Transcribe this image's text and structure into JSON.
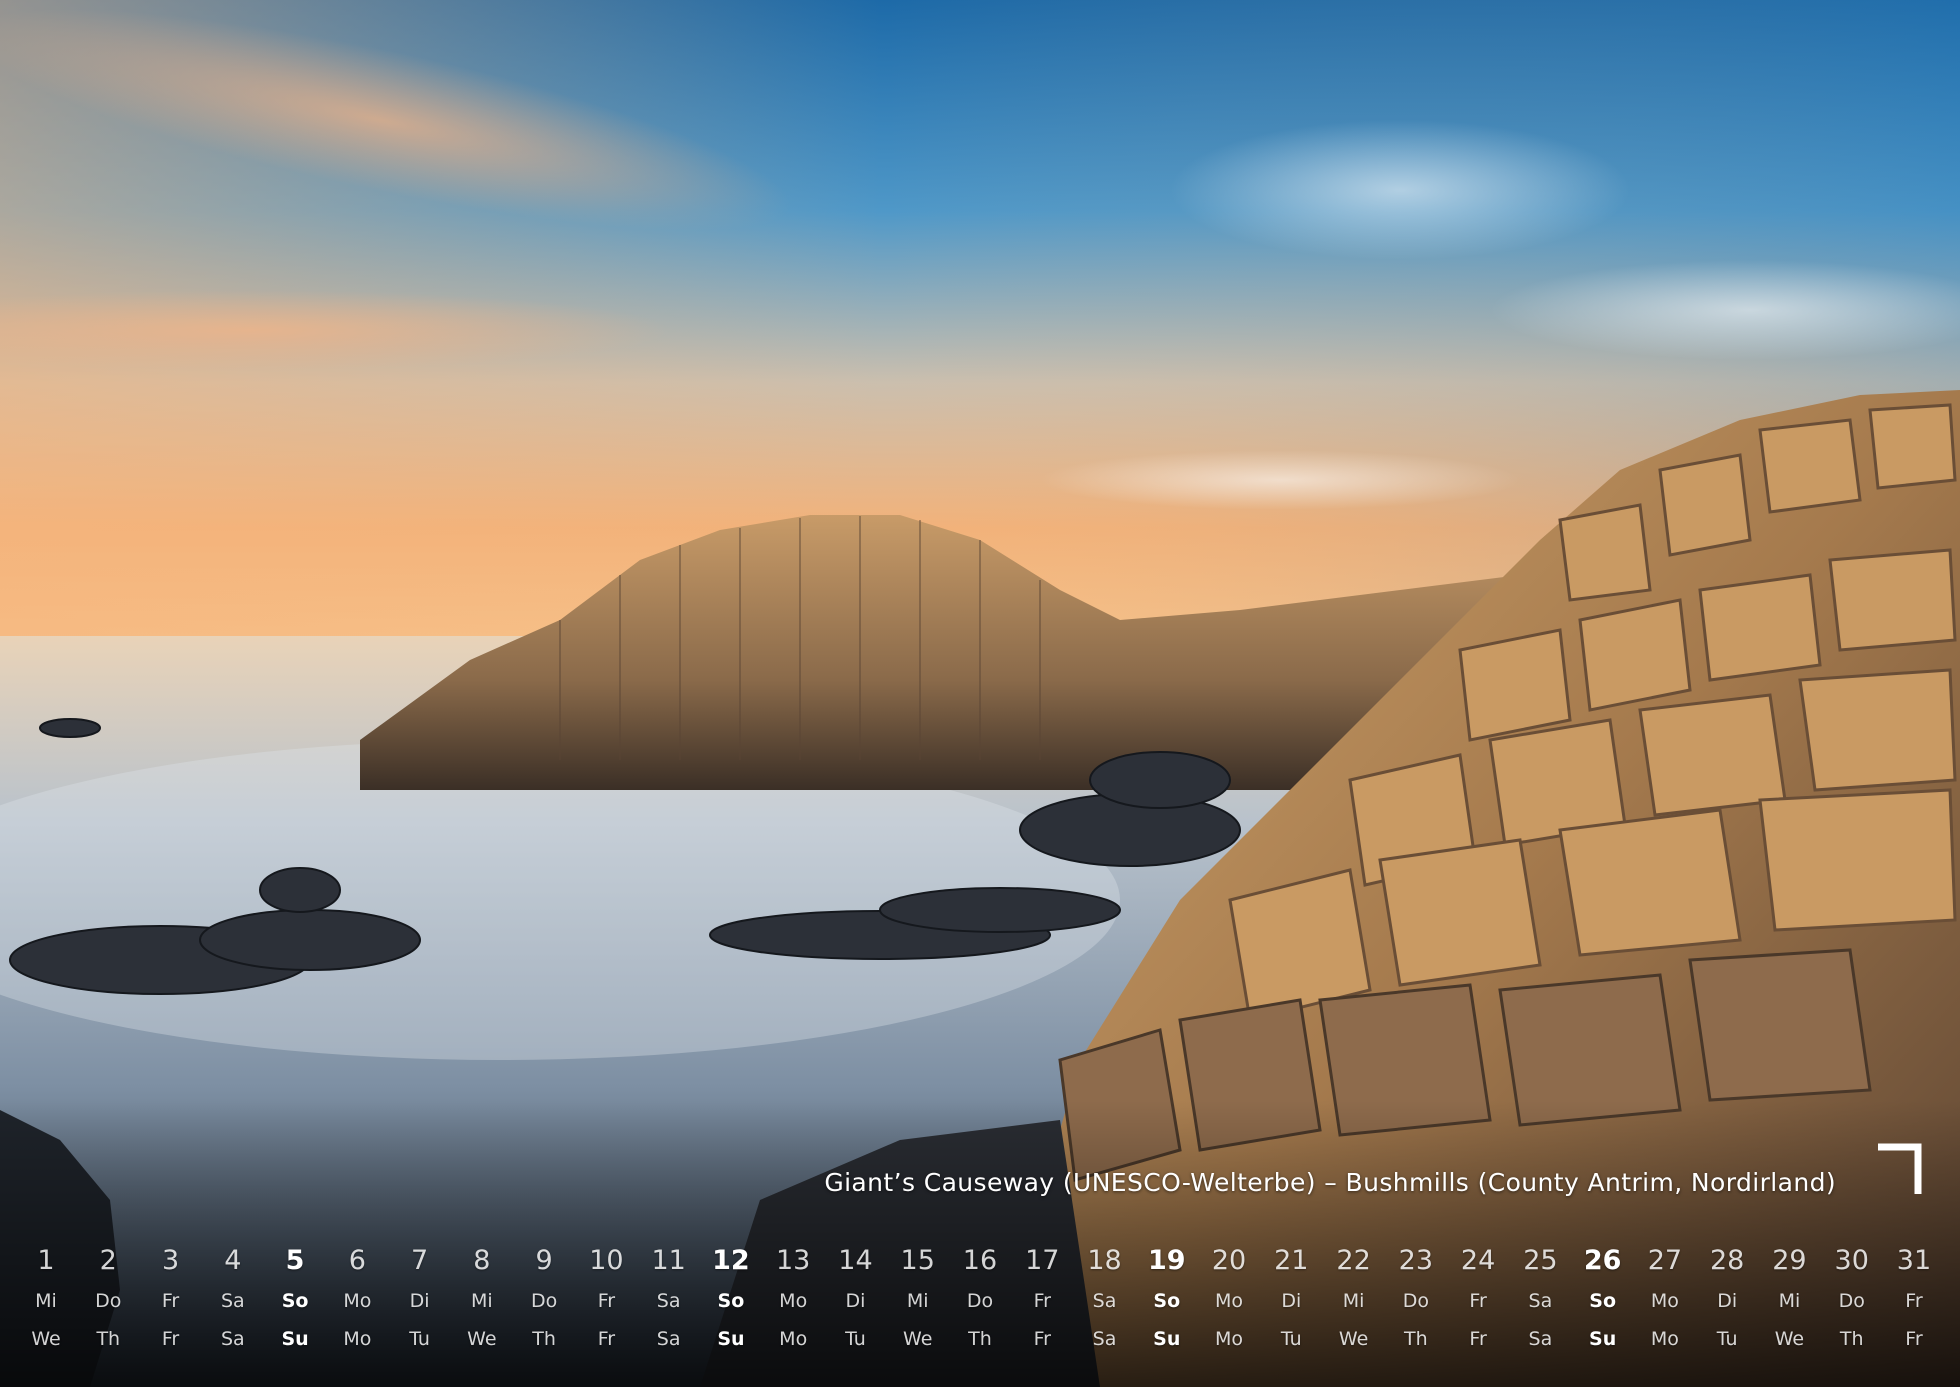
{
  "caption": "Giant’s Causeway (UNESCO-Welterbe) – Bushmills (County Antrim, Nordirland)",
  "month_mark": "7",
  "colors": {
    "text": "#ffffff",
    "sky_top": "#1f6fae",
    "sky_horizon": "#f4b47a",
    "rock": "#b88a58",
    "sea": "#a9b8c6"
  },
  "calendar": {
    "days": [
      {
        "num": "1",
        "de": "Mi",
        "en": "We",
        "sunday": false
      },
      {
        "num": "2",
        "de": "Do",
        "en": "Th",
        "sunday": false
      },
      {
        "num": "3",
        "de": "Fr",
        "en": "Fr",
        "sunday": false
      },
      {
        "num": "4",
        "de": "Sa",
        "en": "Sa",
        "sunday": false
      },
      {
        "num": "5",
        "de": "So",
        "en": "Su",
        "sunday": true
      },
      {
        "num": "6",
        "de": "Mo",
        "en": "Mo",
        "sunday": false
      },
      {
        "num": "7",
        "de": "Di",
        "en": "Tu",
        "sunday": false
      },
      {
        "num": "8",
        "de": "Mi",
        "en": "We",
        "sunday": false
      },
      {
        "num": "9",
        "de": "Do",
        "en": "Th",
        "sunday": false
      },
      {
        "num": "10",
        "de": "Fr",
        "en": "Fr",
        "sunday": false
      },
      {
        "num": "11",
        "de": "Sa",
        "en": "Sa",
        "sunday": false
      },
      {
        "num": "12",
        "de": "So",
        "en": "Su",
        "sunday": true
      },
      {
        "num": "13",
        "de": "Mo",
        "en": "Mo",
        "sunday": false
      },
      {
        "num": "14",
        "de": "Di",
        "en": "Tu",
        "sunday": false
      },
      {
        "num": "15",
        "de": "Mi",
        "en": "We",
        "sunday": false
      },
      {
        "num": "16",
        "de": "Do",
        "en": "Th",
        "sunday": false
      },
      {
        "num": "17",
        "de": "Fr",
        "en": "Fr",
        "sunday": false
      },
      {
        "num": "18",
        "de": "Sa",
        "en": "Sa",
        "sunday": false
      },
      {
        "num": "19",
        "de": "So",
        "en": "Su",
        "sunday": true
      },
      {
        "num": "20",
        "de": "Mo",
        "en": "Mo",
        "sunday": false
      },
      {
        "num": "21",
        "de": "Di",
        "en": "Tu",
        "sunday": false
      },
      {
        "num": "22",
        "de": "Mi",
        "en": "We",
        "sunday": false
      },
      {
        "num": "23",
        "de": "Do",
        "en": "Th",
        "sunday": false
      },
      {
        "num": "24",
        "de": "Fr",
        "en": "Fr",
        "sunday": false
      },
      {
        "num": "25",
        "de": "Sa",
        "en": "Sa",
        "sunday": false
      },
      {
        "num": "26",
        "de": "So",
        "en": "Su",
        "sunday": true
      },
      {
        "num": "27",
        "de": "Mo",
        "en": "Mo",
        "sunday": false
      },
      {
        "num": "28",
        "de": "Di",
        "en": "Tu",
        "sunday": false
      },
      {
        "num": "29",
        "de": "Mi",
        "en": "We",
        "sunday": false
      },
      {
        "num": "30",
        "de": "Do",
        "en": "Th",
        "sunday": false
      },
      {
        "num": "31",
        "de": "Fr",
        "en": "Fr",
        "sunday": false
      }
    ]
  }
}
